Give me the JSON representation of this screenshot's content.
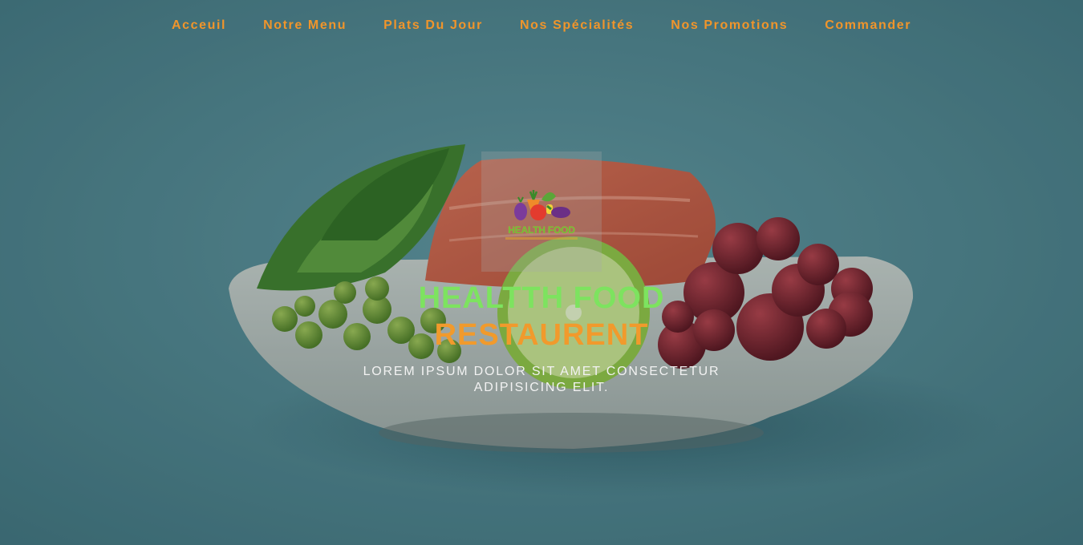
{
  "nav": {
    "items": [
      {
        "label": "Acceuil"
      },
      {
        "label": "Notre Menu"
      },
      {
        "label": "Plats Du Jour"
      },
      {
        "label": "Nos Spécialités"
      },
      {
        "label": "Nos Promotions"
      },
      {
        "label": "Commander"
      }
    ]
  },
  "logo": {
    "name": "HEALTH FOOD",
    "icon": "vegetables-basket-icon"
  },
  "hero": {
    "title_line1": "HEALTTH FOOD",
    "title_line2": "RESTAURENT",
    "subtitle": "LOREM IPSUM DOLOR SIT AMET CONSECTETUR ADIPISICING ELIT.",
    "image": "salad-bowl-photo"
  },
  "colors": {
    "background": "#4c7d86",
    "nav_text": "#f0952b",
    "title_green": "#7de35f",
    "title_orange": "#f19a2c",
    "subtitle_text": "#f2f2f2"
  }
}
